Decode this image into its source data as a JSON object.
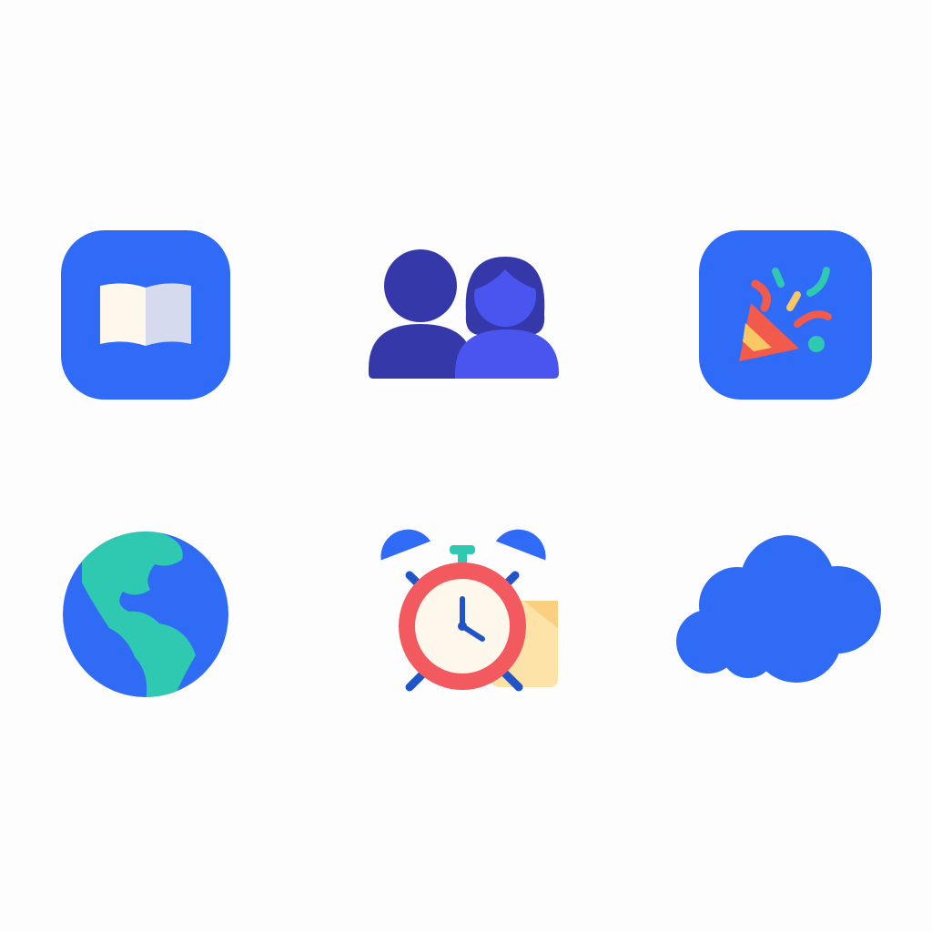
{
  "icons": [
    {
      "name": "book-icon"
    },
    {
      "name": "users-icon"
    },
    {
      "name": "party-popper-icon"
    },
    {
      "name": "globe-icon"
    },
    {
      "name": "alarm-clock-icon"
    },
    {
      "name": "cloud-icon"
    }
  ],
  "colors": {
    "background": "#fdfdfd",
    "primary_blue": "#306bf8",
    "indigo_dark": "#3438a8",
    "indigo_light": "#4a55f0",
    "teal": "#2ec9b0",
    "red": "#f25a5f",
    "yellow": "#fde3a7",
    "cream": "#fdf7ec",
    "dark_blue": "#1f55c8"
  }
}
